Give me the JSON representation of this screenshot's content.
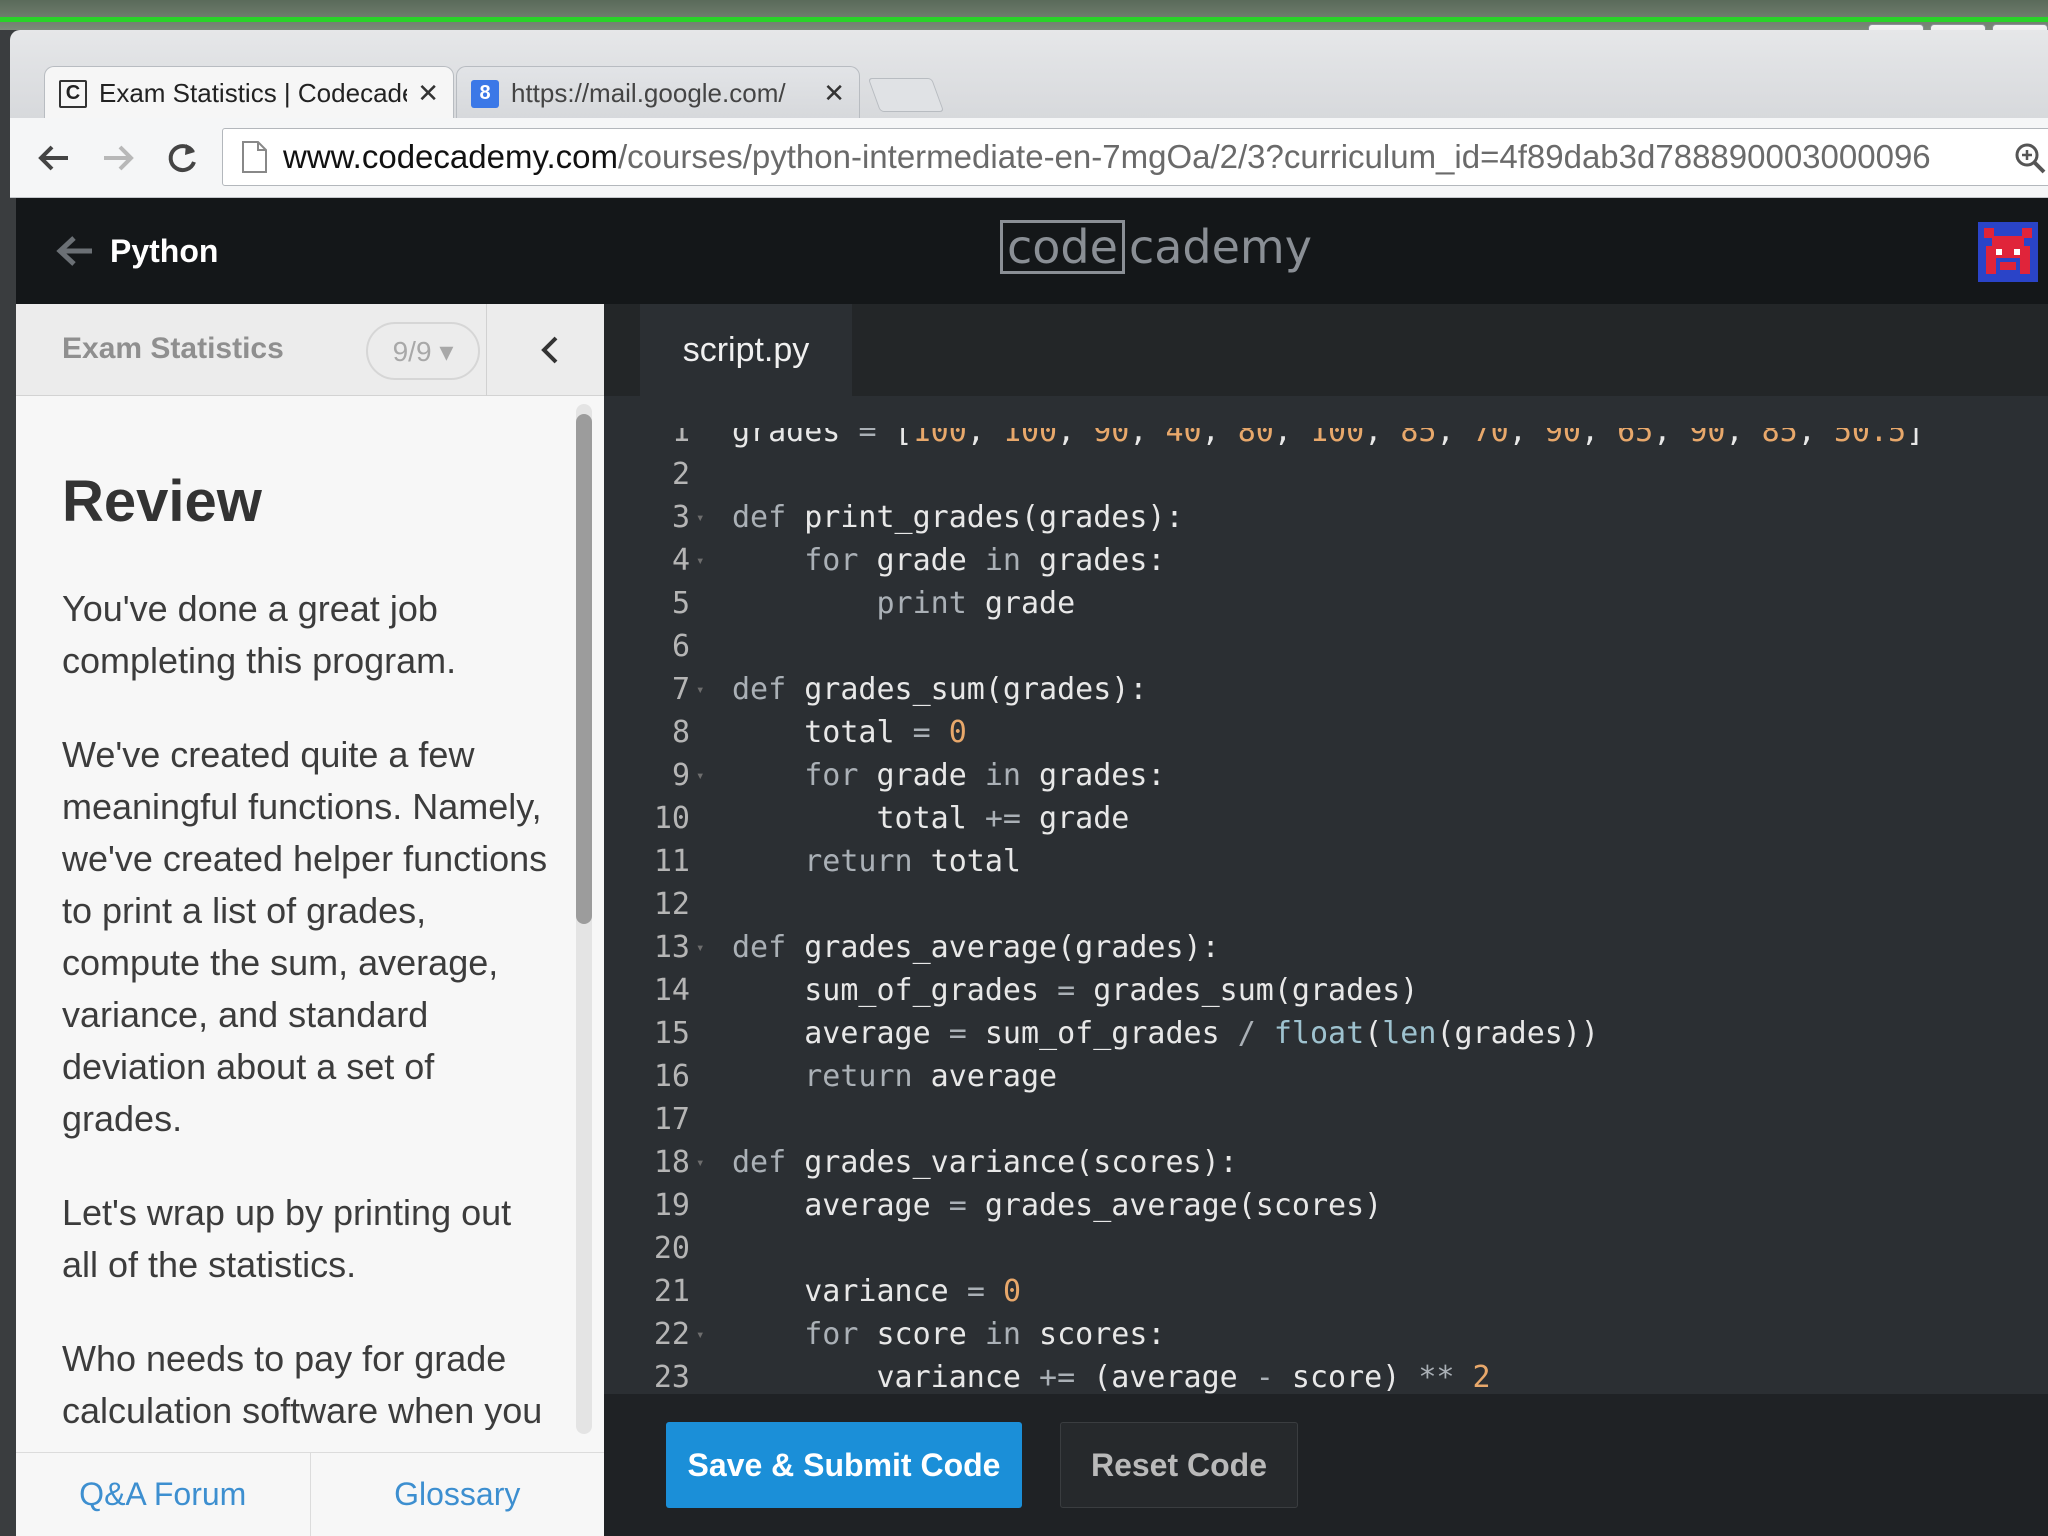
{
  "browser": {
    "tabs": [
      {
        "title": "Exam Statistics | Codecade",
        "favicon": "C",
        "active": true
      },
      {
        "title": "https://mail.google.com/",
        "favicon": "8",
        "active": false
      }
    ],
    "url": {
      "host": "www.codecademy.com",
      "path": "/courses/python-intermediate-en-7mgOa/2/3?curriculum_id=4f89dab3d788890003000096"
    }
  },
  "app": {
    "back_label": "Python",
    "logo_left": "code",
    "logo_right": "cademy"
  },
  "lesson": {
    "name": "Exam Statistics",
    "progress": "9/9 ▾",
    "heading": "Review",
    "paragraphs": [
      "You've done a great job completing this program.",
      "We've created quite a few meaningful functions. Namely, we've created helper functions to print a list of grades, compute the sum, average, variance, and standard deviation about a set of grades.",
      "Let's wrap up by printing out all of the statistics.",
      "Who needs to pay for grade calculation software when you can write your own? :)"
    ],
    "footer_links": [
      "Q&A Forum",
      "Glossary"
    ]
  },
  "editor": {
    "file_tab": "script.py",
    "submit_label": "Save & Submit Code",
    "reset_label": "Reset Code",
    "lines": [
      "grades = [100, 100, 90, 40, 80, 100, 85, 70, 90, 65, 90, 85, 50.5]",
      "",
      "def print_grades(grades):",
      "    for grade in grades:",
      "        print grade",
      "",
      "def grades_sum(grades):",
      "    total = 0",
      "    for grade in grades:",
      "        total += grade",
      "    return total",
      "",
      "def grades_average(grades):",
      "    sum_of_grades = grades_sum(grades)",
      "    average = sum_of_grades / float(len(grades))",
      "    return average",
      "",
      "def grades_variance(scores):",
      "    average = grades_average(scores)",
      "",
      "    variance = 0",
      "    for score in scores:",
      "        variance += (average - score) ** 2"
    ],
    "fold_lines": [
      3,
      4,
      7,
      9,
      13,
      18,
      22
    ]
  },
  "colors": {
    "accent": "#1b8fd8",
    "editor_bg": "#2b2f33",
    "number": "#e8a86b",
    "link": "#3d8fd0"
  }
}
